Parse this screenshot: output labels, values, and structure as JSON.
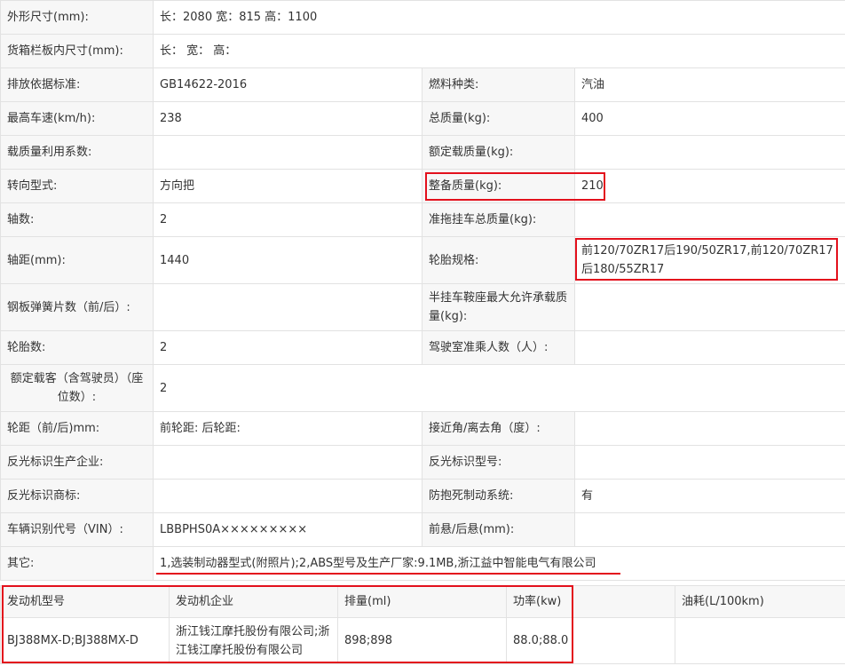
{
  "spec_rows": [
    {
      "label1": "外形尺寸(mm):",
      "value1": "长：2080 宽：815 高：1100"
    },
    {
      "label1": "货箱栏板内尺寸(mm):",
      "value1": "长： 宽： 高："
    },
    {
      "label1": "排放依据标准:",
      "value1": "GB14622-2016",
      "label2": "燃料种类:",
      "value2": "汽油"
    },
    {
      "label1": "最高车速(km/h):",
      "value1": "238",
      "label2": "总质量(kg):",
      "value2": "400"
    },
    {
      "label1": "载质量利用系数:",
      "value1": "",
      "label2": "额定载质量(kg):",
      "value2": ""
    },
    {
      "label1": "转向型式:",
      "value1": "方向把",
      "label2": "整备质量(kg):",
      "value2": "210"
    },
    {
      "label1": "轴数:",
      "value1": "2",
      "label2": "准拖挂车总质量(kg):",
      "value2": ""
    },
    {
      "label1": "轴距(mm):",
      "value1": "1440",
      "label2": "轮胎规格:",
      "value2": "前120/70ZR17后190/50ZR17,前120/70ZR17后180/55ZR17"
    },
    {
      "label1": "钢板弹簧片数（前/后）:",
      "value1": "",
      "label2": "半挂车鞍座最大允许承载质量(kg):",
      "value2": ""
    },
    {
      "label1": "轮胎数:",
      "value1": "2",
      "label2": "驾驶室准乘人数（人）:",
      "value2": ""
    },
    {
      "label1": "额定载客（含驾驶员）（座位数）:",
      "value1": "2"
    },
    {
      "label1": "轮距（前/后)mm:",
      "value1": "前轮距: 后轮距:",
      "label2": "接近角/离去角（度）:",
      "value2": ""
    },
    {
      "label1": "反光标识生产企业:",
      "value1": "",
      "label2": "反光标识型号:",
      "value2": ""
    },
    {
      "label1": "反光标识商标:",
      "value1": "",
      "label2": "防抱死制动系统:",
      "value2": "有"
    },
    {
      "label1": "车辆识别代号（VIN）:",
      "value1": "LBBPHS0A×××××××××",
      "label2": "前悬/后悬(mm):",
      "value2": ""
    },
    {
      "label1": "其它:",
      "value1": "1,选装制动器型式(附照片);2,ABS型号及生产厂家:9.1MB,浙江益中智能电气有限公司"
    }
  ],
  "engine": {
    "headers": [
      "发动机型号",
      "发动机企业",
      "排量(ml)",
      "功率(kw)",
      "油耗(L/100km)"
    ],
    "row": [
      "BJ388MX-D;BJ388MX-D",
      "浙江钱江摩托股份有限公司;浙江钱江摩托股份有限公司",
      "898;898",
      "88.0;88.0",
      ""
    ]
  },
  "colors": {
    "highlight": "#e3101c",
    "label_bg": "#f7f7f7",
    "border": "#e2e2e2"
  }
}
